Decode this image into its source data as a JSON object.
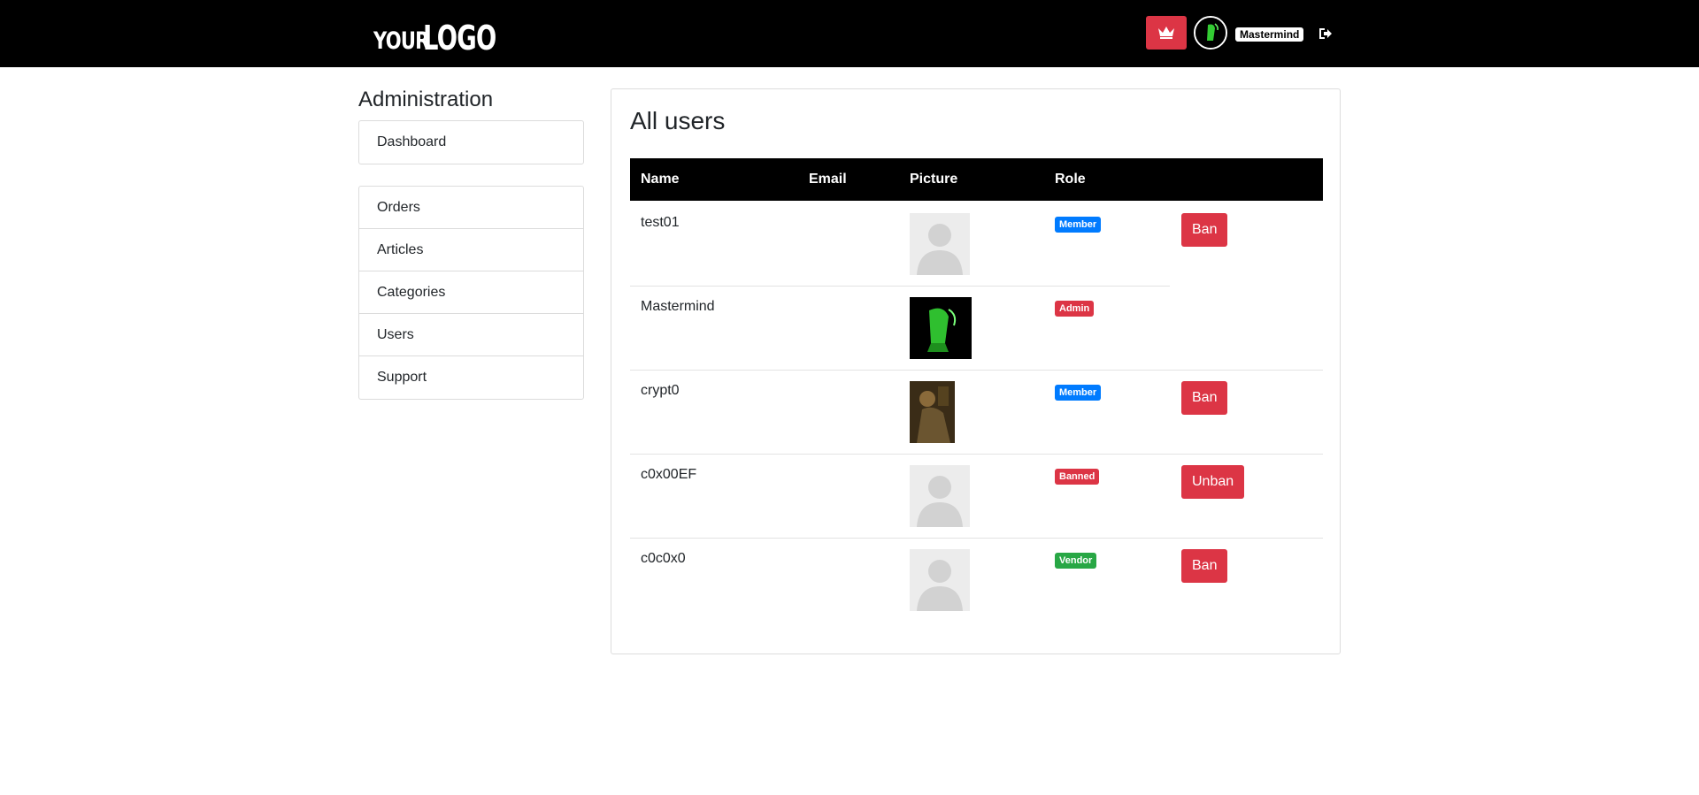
{
  "header": {
    "logo_part1": "YOUR",
    "logo_part2": "LOGO",
    "username": "Mastermind",
    "crown_icon": "crown-icon",
    "logout_icon": "logout-icon",
    "accent_color": "#dc3545"
  },
  "sidebar": {
    "title": "Administration",
    "group1": [
      {
        "label": "Dashboard"
      }
    ],
    "group2": [
      {
        "label": "Orders"
      },
      {
        "label": "Articles"
      },
      {
        "label": "Categories"
      },
      {
        "label": "Users"
      },
      {
        "label": "Support"
      }
    ]
  },
  "main": {
    "title": "All users",
    "columns": [
      "Name",
      "Email",
      "Picture",
      "Role"
    ],
    "rows": [
      {
        "name": "test01",
        "email": "",
        "picture": "default-avatar",
        "role": "Member",
        "role_color": "#007bff",
        "action": "Ban"
      },
      {
        "name": "Mastermind",
        "email": "",
        "picture": "reaper-avatar",
        "role": "Admin",
        "role_color": "#dc3545",
        "action": ""
      },
      {
        "name": "crypt0",
        "email": "",
        "picture": "painting-avatar",
        "role": "Member",
        "role_color": "#007bff",
        "action": "Ban"
      },
      {
        "name": "c0x00EF",
        "email": "",
        "picture": "default-avatar",
        "role": "Banned",
        "role_color": "#dc3545",
        "action": "Unban"
      },
      {
        "name": "c0c0x0",
        "email": "",
        "picture": "default-avatar",
        "role": "Vendor",
        "role_color": "#28a745",
        "action": "Ban"
      }
    ]
  }
}
